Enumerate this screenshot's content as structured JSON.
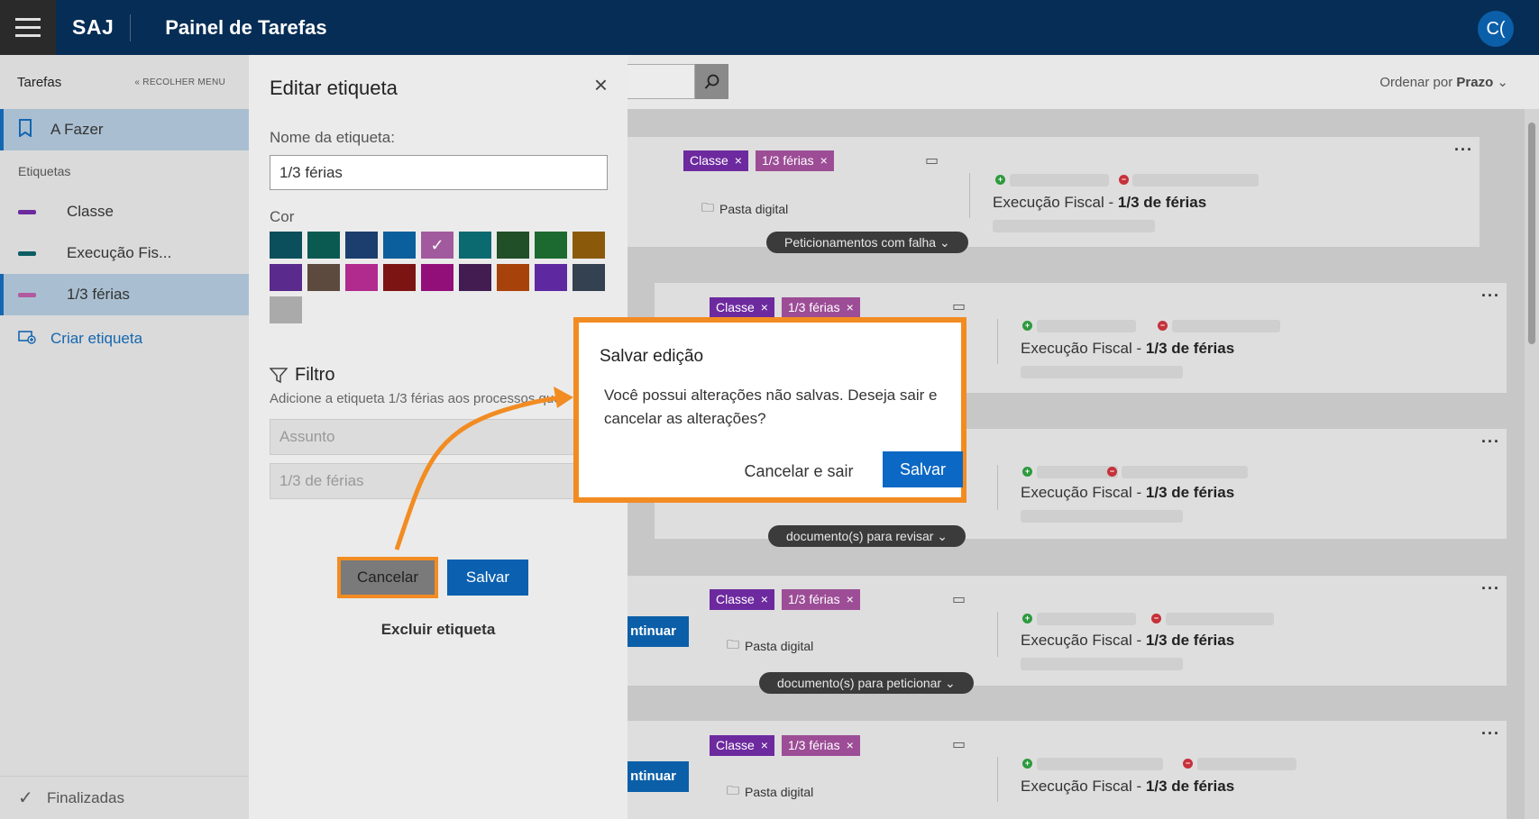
{
  "topbar": {
    "brand": "SAJ",
    "title": "Painel de Tarefas",
    "avatar": "C("
  },
  "sidebar": {
    "header": "Tarefas",
    "collapse": "« RECOLHER MENU",
    "todo": "A Fazer",
    "section": "Etiquetas",
    "labels": [
      {
        "name": "Classe",
        "color": "#6d2a9f"
      },
      {
        "name": "Execução Fis...",
        "color": "#0b5d63"
      },
      {
        "name": "1/3 férias",
        "color": "#b25a9f"
      }
    ],
    "create": "Criar etiqueta",
    "finished": "Finalizadas"
  },
  "edit_panel": {
    "title": "Editar etiqueta",
    "name_label": "Nome da etiqueta:",
    "name_value": "1/3 férias",
    "color_label": "Cor",
    "swatches": [
      "#0b4e5c",
      "#0b5a52",
      "#1b3e6e",
      "#0b5f9c",
      "#a15a9e",
      "#0b6a6f",
      "#214f27",
      "#1c6a30",
      "#8a5a0a",
      "#5a2a8c",
      "#5d4a3e",
      "#b12a8e",
      "#7d1414",
      "#920f7a",
      "#431d52",
      "#a8420b",
      "#5d28a0",
      "#334150",
      "#aaaaaa"
    ],
    "selected_swatch": 4,
    "check": "✓",
    "filter_title": "Filtro",
    "filter_desc": "Adicione a etiqueta 1/3 férias aos processos que:",
    "field1": "Assunto",
    "field2": "1/3 de férias",
    "cancel": "Cancelar",
    "save": "Salvar",
    "delete": "Excluir etiqueta"
  },
  "main": {
    "sort_label": "Ordenar por",
    "sort_value": "Prazo",
    "tag_classe": "Classe",
    "tag_ferias": "1/3 férias",
    "pasta": "Pasta digital",
    "exec_prefix": "Execução Fiscal - ",
    "exec_bold": "1/3 de férias",
    "pills": [
      "Peticionamentos com falha",
      "documento(s) para revisar",
      "documento(s) para peticionar"
    ],
    "continuar": "ntinuar"
  },
  "dialog": {
    "title": "Salvar edição",
    "text": "Você possui alterações não salvas. Deseja sair e cancelar as alterações?",
    "cancel": "Cancelar e sair",
    "save": "Salvar"
  }
}
